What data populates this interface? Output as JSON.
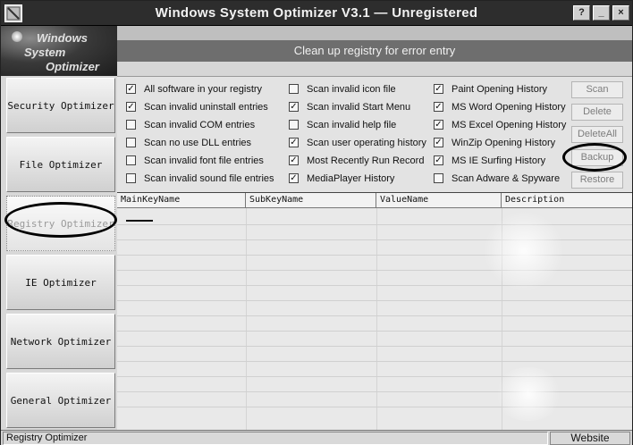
{
  "window": {
    "title": "Windows System Optimizer V3.1 — Unregistered",
    "controls": [
      "?",
      "_",
      "×"
    ]
  },
  "logo": {
    "line1": "Windows",
    "line2": "System",
    "line3": "Optimizer"
  },
  "header": {
    "subtitle": "Clean up registry for error entry"
  },
  "sidebar": {
    "items": [
      {
        "label": "Security Optimizer"
      },
      {
        "label": "File Optimizer"
      },
      {
        "label": "Registry Optimizer",
        "active": true
      },
      {
        "label": "IE Optimizer"
      },
      {
        "label": "Network Optimizer"
      },
      {
        "label": "General Optimizer"
      }
    ]
  },
  "options": {
    "col1": [
      {
        "label": "All software in your registry",
        "checked": true
      },
      {
        "label": "Scan invalid uninstall entries",
        "checked": true
      },
      {
        "label": "Scan invalid COM entries",
        "checked": false
      },
      {
        "label": "Scan no use DLL entries",
        "checked": false
      },
      {
        "label": "Scan invalid font file entries",
        "checked": false
      },
      {
        "label": "Scan invalid sound file entries",
        "checked": false
      }
    ],
    "col2": [
      {
        "label": "Scan invalid icon file",
        "checked": false
      },
      {
        "label": "Scan invalid Start Menu",
        "checked": true
      },
      {
        "label": "Scan invalid help file",
        "checked": false
      },
      {
        "label": "Scan user operating history",
        "checked": true
      },
      {
        "label": "Most Recently Run Record",
        "checked": true
      },
      {
        "label": "MediaPlayer History",
        "checked": true
      }
    ],
    "col3": [
      {
        "label": "Paint Opening History",
        "checked": true
      },
      {
        "label": "MS Word Opening History",
        "checked": true
      },
      {
        "label": "MS Excel Opening History",
        "checked": true
      },
      {
        "label": "WinZip Opening History",
        "checked": true
      },
      {
        "label": "MS IE Surfing History",
        "checked": true
      },
      {
        "label": "Scan Adware & Spyware",
        "checked": false
      }
    ]
  },
  "actions": {
    "scan": "Scan",
    "delete": "Delete",
    "delete_all": "DeleteAll",
    "backup": "Backup",
    "restore": "Restore"
  },
  "table": {
    "columns": [
      "MainKeyName",
      "SubKeyName",
      "ValueName",
      "Description"
    ]
  },
  "statusbar": {
    "left": "Registry Optimizer",
    "right": "Website"
  },
  "colors": {
    "titlebar": "#2d2d2d",
    "header_bar": "#6e6e6e",
    "panel": "#e3e3e3"
  }
}
